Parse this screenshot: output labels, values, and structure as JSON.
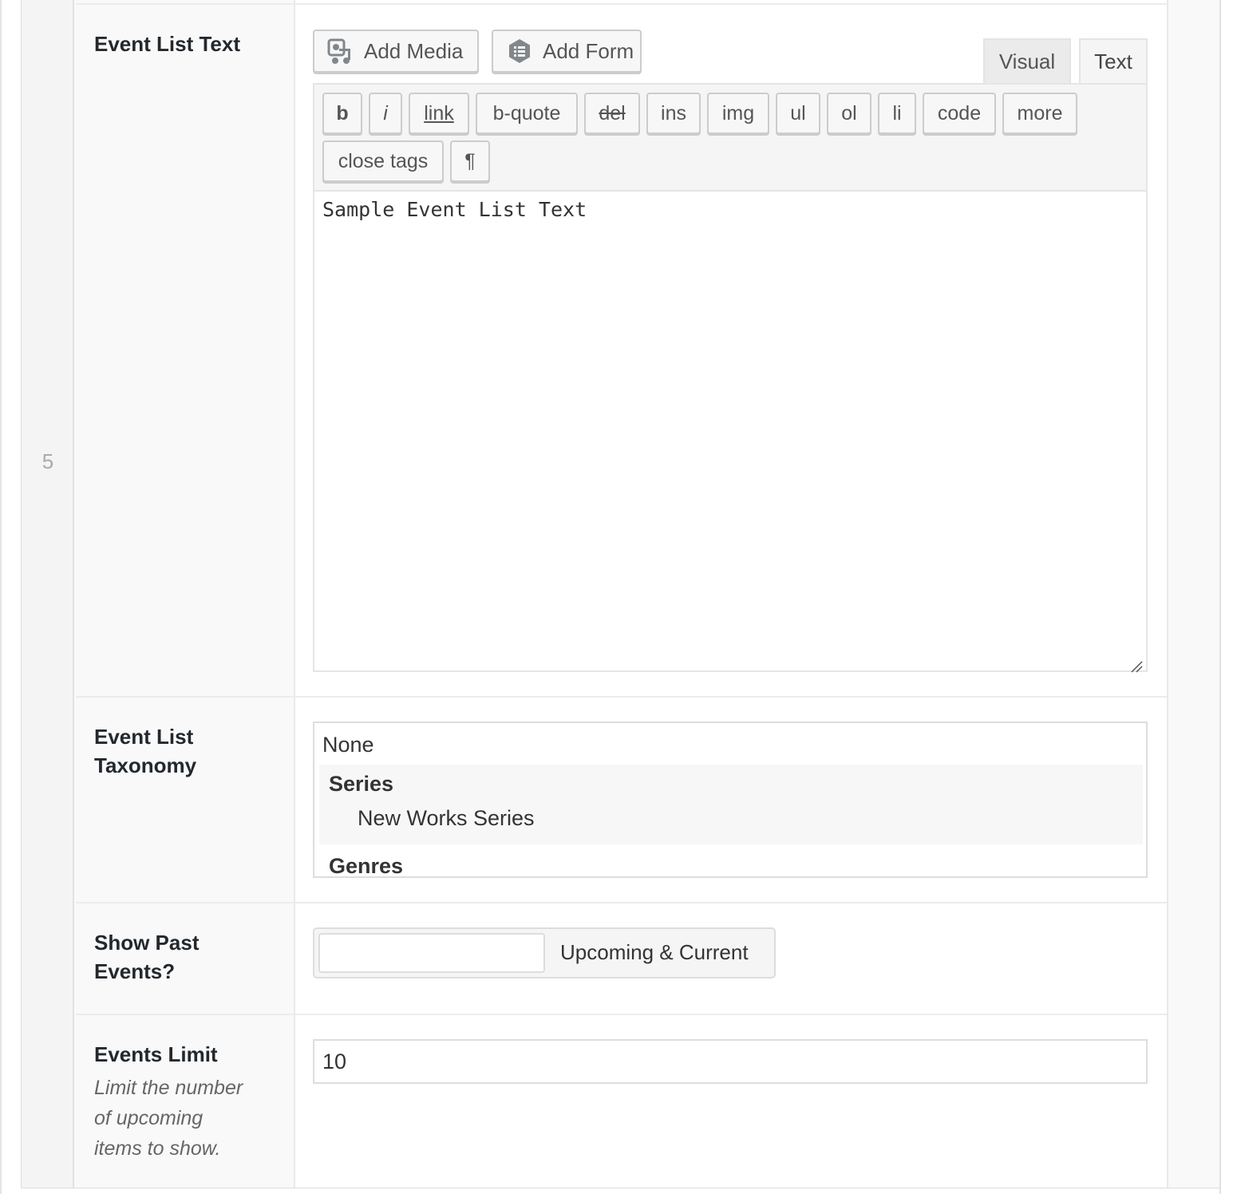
{
  "row": {
    "number": "5"
  },
  "fields": {
    "event_list_text": {
      "label": "Event List Text",
      "media_buttons": {
        "add_media": "Add Media",
        "add_form": "Add Form"
      },
      "tabs": {
        "visual": "Visual",
        "text": "Text",
        "active": "Text"
      },
      "quicktags": [
        "b",
        "i",
        "link",
        "b-quote",
        "del",
        "ins",
        "img",
        "ul",
        "ol",
        "li",
        "code",
        "more",
        "close tags",
        "¶"
      ],
      "content": "Sample Event List Text"
    },
    "event_list_taxonomy": {
      "label_line1": "Event List",
      "label_line2": "Taxonomy",
      "options": {
        "none": "None",
        "series_group": "Series",
        "series_item": "New Works Series",
        "genres_group": "Genres"
      }
    },
    "show_past_events": {
      "label_line1": "Show Past",
      "label_line2": "Events?",
      "option_label": "Upcoming & Current"
    },
    "events_limit": {
      "label": "Events Limit",
      "description_lines": [
        "Limit the number",
        "of upcoming",
        "items to show."
      ],
      "value": "10"
    }
  }
}
